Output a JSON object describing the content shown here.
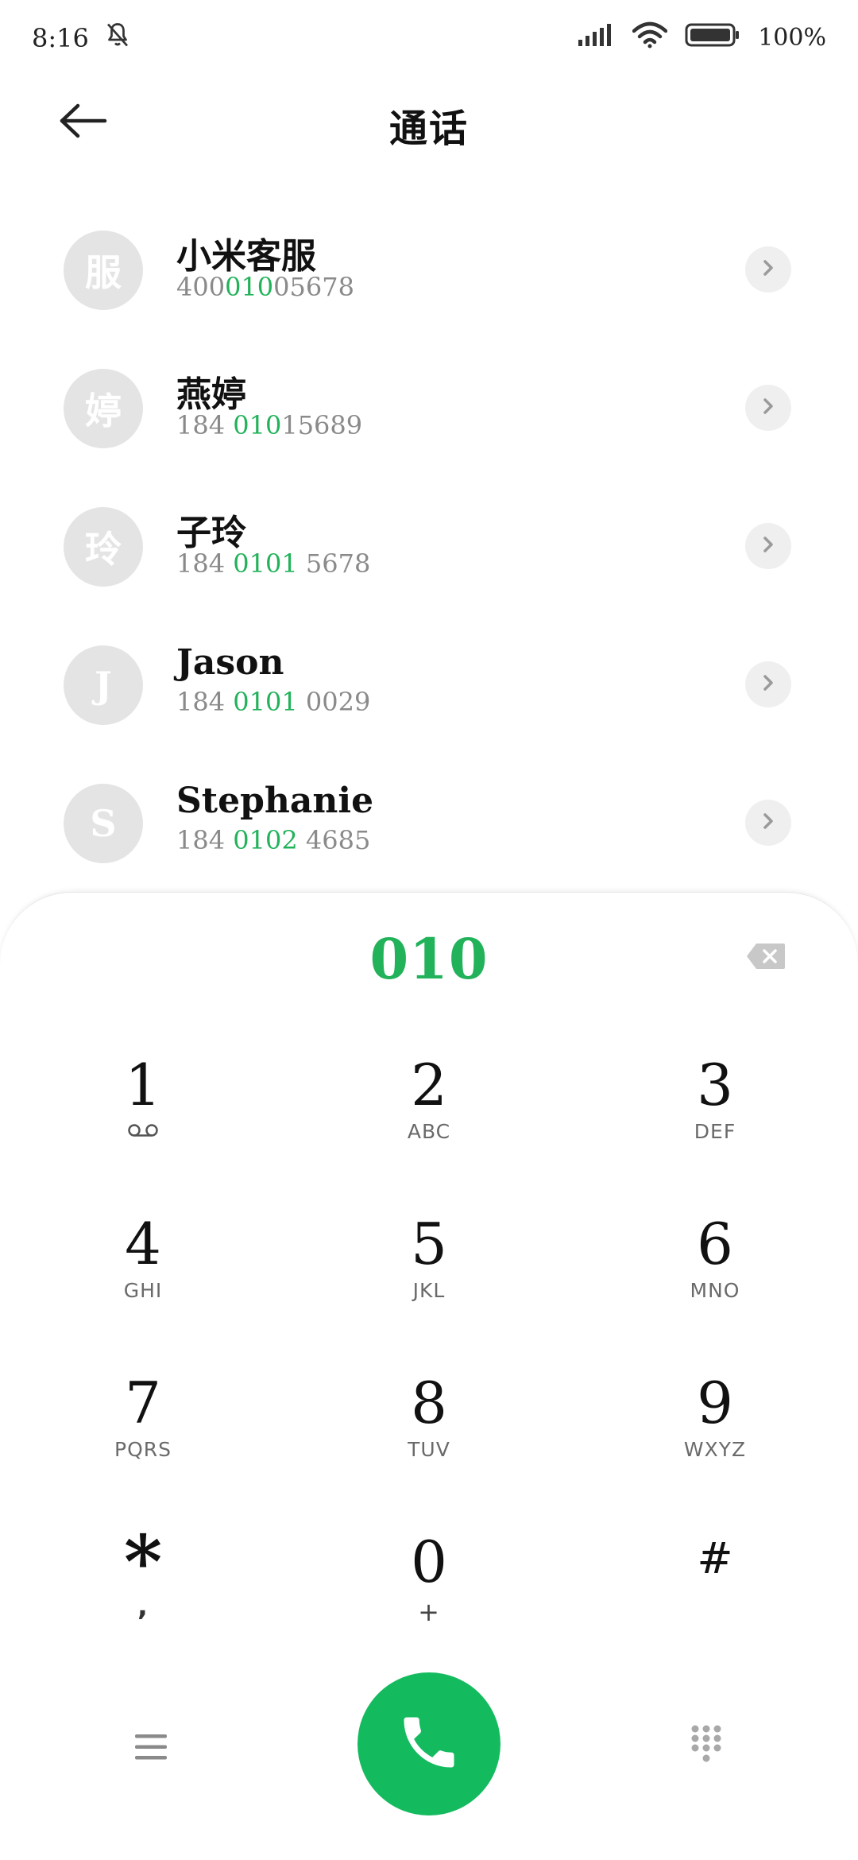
{
  "status_bar": {
    "time": "8:16",
    "battery": "100%",
    "icons": [
      "bell-off-icon",
      "signal-icon",
      "wifi-icon",
      "battery-icon"
    ]
  },
  "header": {
    "title": "通话",
    "back_icon": "back-arrow-icon"
  },
  "contacts": [
    {
      "avatar": "服",
      "name": "小米客服",
      "num_pre": "400",
      "num_match": "010",
      "num_post": "05678"
    },
    {
      "avatar": "婷",
      "name": "燕婷",
      "num_pre": "184 ",
      "num_match": "010",
      "num_post": "15689"
    },
    {
      "avatar": "玲",
      "name": "子玲",
      "num_pre": "184 ",
      "num_match": "0101",
      "num_post": " 5678"
    },
    {
      "avatar": "J",
      "name": "Jason",
      "num_pre": "184 ",
      "num_match": "0101",
      "num_post": " 0029"
    },
    {
      "avatar": "S",
      "name": "Stephanie",
      "num_pre": "184 ",
      "num_match": "0102",
      "num_post": " 4685"
    }
  ],
  "dialer": {
    "input": "010",
    "backspace_icon": "backspace-icon"
  },
  "keypad": [
    {
      "digit": "1",
      "letters": "voicemail-icon"
    },
    {
      "digit": "2",
      "letters": "ABC"
    },
    {
      "digit": "3",
      "letters": "DEF"
    },
    {
      "digit": "4",
      "letters": "GHI"
    },
    {
      "digit": "5",
      "letters": "JKL"
    },
    {
      "digit": "6",
      "letters": "MNO"
    },
    {
      "digit": "7",
      "letters": "PQRS"
    },
    {
      "digit": "8",
      "letters": "TUV"
    },
    {
      "digit": "9",
      "letters": "WXYZ"
    },
    {
      "digit": "*",
      "letters": ","
    },
    {
      "digit": "0",
      "letters": "+"
    },
    {
      "digit": "#",
      "letters": ""
    }
  ],
  "colors": {
    "accent": "#22b25a",
    "call_button": "#14bb5e",
    "avatar_bg": "#e4e4e4"
  },
  "bottom_bar": {
    "menu_icon": "menu-icon",
    "call_icon": "phone-icon",
    "keypad_icon": "dialpad-icon"
  }
}
